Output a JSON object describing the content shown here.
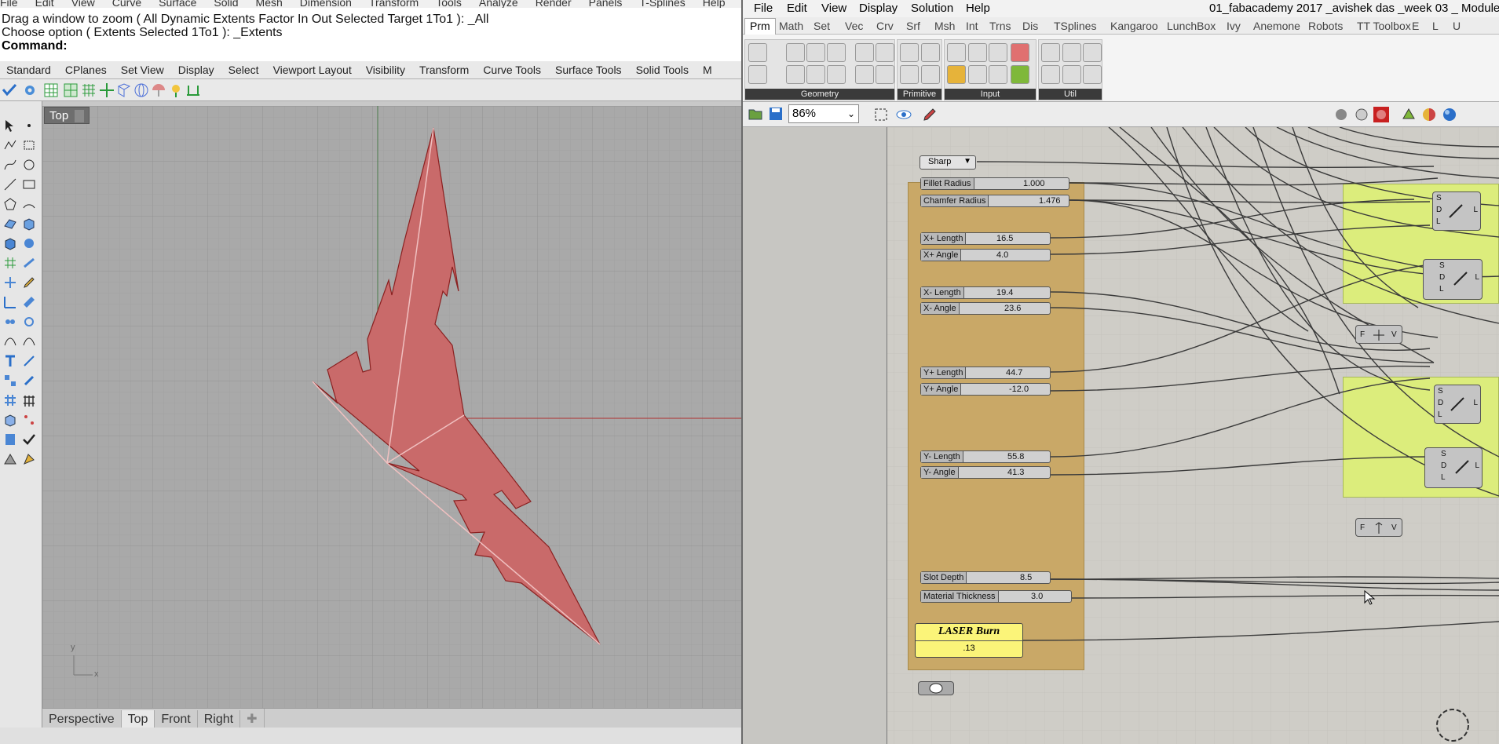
{
  "rhino": {
    "menu": [
      "File",
      "Edit",
      "View",
      "Curve",
      "Surface",
      "Solid",
      "Mesh",
      "Dimension",
      "Transform",
      "Tools",
      "Analyze",
      "Render",
      "Panels",
      "T-Splines",
      "Help"
    ],
    "command_history": [
      "Drag a window to zoom ( All  Dynamic  Extents  Factor  In  Out  Selected  Target  1To1 ): _All",
      "Choose option ( Extents  Selected  1To1 ): _Extents"
    ],
    "command_prompt": "Command:",
    "toolbar_tabs": [
      "Standard",
      "CPlanes",
      "Set View",
      "Display",
      "Select",
      "Viewport Layout",
      "Visibility",
      "Transform",
      "Curve Tools",
      "Surface Tools",
      "Solid Tools",
      "M"
    ],
    "viewport_title": "Top",
    "viewport_tabs": [
      "Perspective",
      "Top",
      "Front",
      "Right"
    ],
    "active_viewport_tab": "Top",
    "axis_labels": {
      "y": "y",
      "x": "x"
    },
    "shape_color": "#c96a6a"
  },
  "gh": {
    "menu": [
      "File",
      "Edit",
      "View",
      "Display",
      "Solution",
      "Help"
    ],
    "title": "01_fabacademy 2017 _avishek das _week 03 _ Module",
    "tabs": [
      "Prm",
      "Math",
      "Set",
      "Vec",
      "Crv",
      "Srf",
      "Msh",
      "Int",
      "Trns",
      "Dis",
      "TSplines",
      "Kangaroo",
      "LunchBox",
      "Ivy",
      "Anemone",
      "Robots",
      "TT Toolbox",
      "E",
      "L",
      "U"
    ],
    "active_tab": "Prm",
    "ribbon_groups": [
      "Geometry",
      "Primitive",
      "Input",
      "Util"
    ],
    "zoom": "86%",
    "value_list": "Sharp",
    "sliders": [
      {
        "label": "Fillet Radius",
        "value": "1.000"
      },
      {
        "label": "Chamfer Radius",
        "value": "1.476"
      },
      {
        "label": "X+ Length",
        "value": "16.5"
      },
      {
        "label": "X+ Angle",
        "value": "4.0"
      },
      {
        "label": "X- Length",
        "value": "19.4"
      },
      {
        "label": "X- Angle",
        "value": "23.6"
      },
      {
        "label": "Y+ Length",
        "value": "44.7"
      },
      {
        "label": "Y+ Angle",
        "value": "-12.0"
      },
      {
        "label": "Y- Length",
        "value": "55.8"
      },
      {
        "label": "Y- Angle",
        "value": "41.3"
      },
      {
        "label": "Slot Depth",
        "value": "8.5"
      },
      {
        "label": "Material Thickness",
        "value": "3.0"
      }
    ],
    "laser": {
      "title": "LASER Burn",
      "value": ".13"
    },
    "comp_inputs": [
      "S",
      "D",
      "L"
    ],
    "comp_output": "L"
  }
}
